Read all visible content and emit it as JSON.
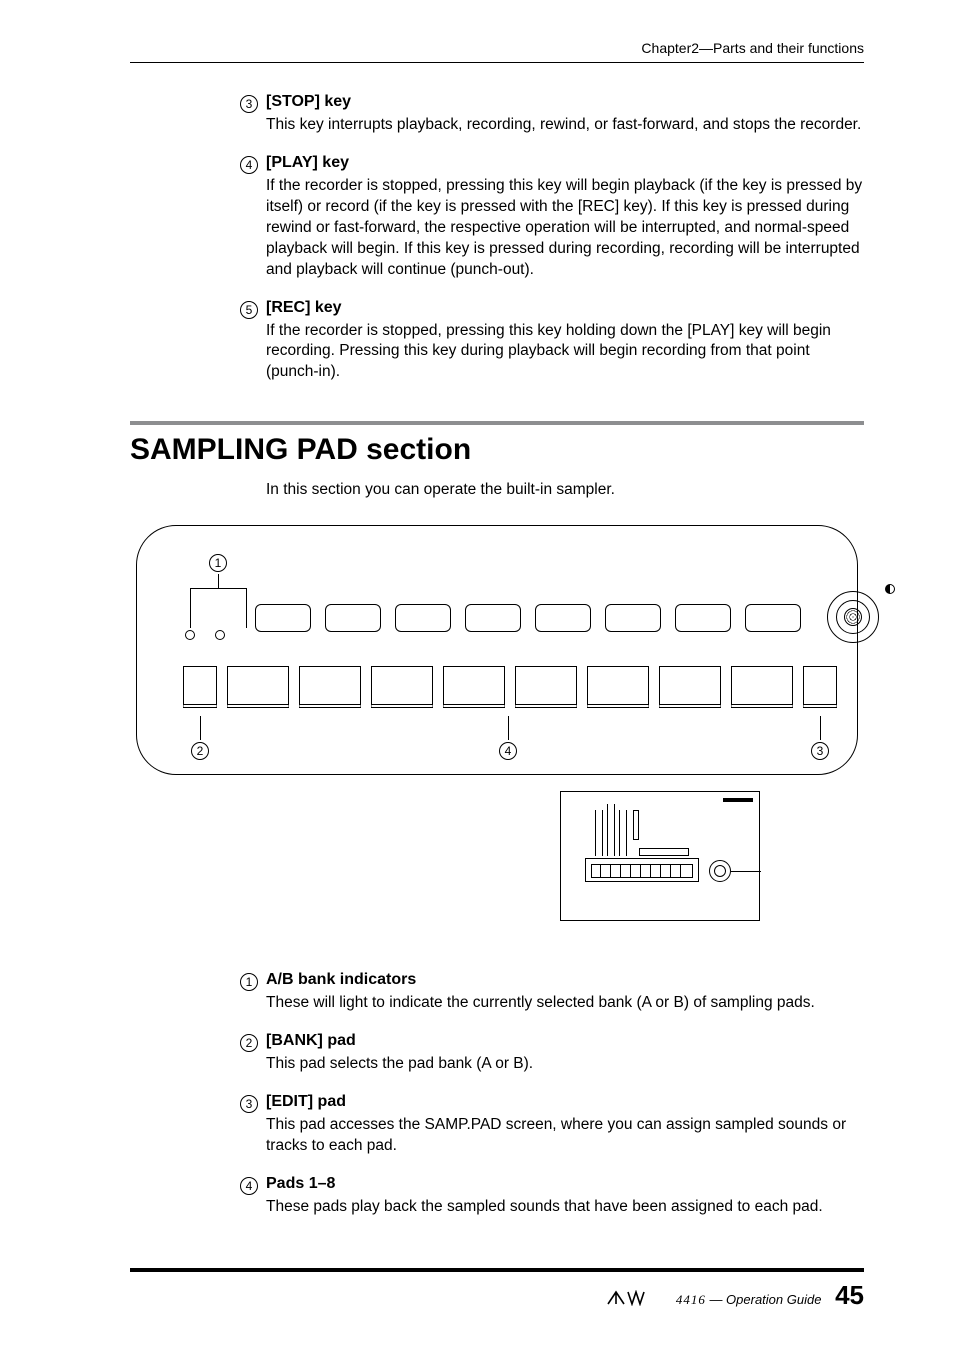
{
  "header": {
    "chapter": "Chapter2—Parts and their functions"
  },
  "top_items": [
    {
      "marker": "3",
      "title": "[STOP] key",
      "desc": "This key interrupts playback, recording, rewind, or fast-forward, and stops the recorder."
    },
    {
      "marker": "4",
      "title": "[PLAY] key",
      "desc": "If the recorder is stopped, pressing this key will begin playback (if the key is pressed by itself) or record (if the key is pressed with the [REC] key). If this key is pressed during rewind or fast-forward, the respective operation will be interrupted, and normal-speed playback will begin. If this key is pressed during recording, recording will be interrupted and playback will continue (punch-out)."
    },
    {
      "marker": "5",
      "title": "[REC] key",
      "desc": "If the recorder is stopped, pressing this key holding down the [PLAY] key will begin recording. Pressing this key during playback will begin recording from that point (punch-in)."
    }
  ],
  "section": {
    "title": "SAMPLING PAD section",
    "intro": "In this section you can operate the built-in sampler."
  },
  "callouts": {
    "c1": "1",
    "c2": "2",
    "c3": "3",
    "c4": "4"
  },
  "bottom_items": [
    {
      "marker": "1",
      "title": "A/B bank indicators",
      "desc": "These will light to indicate the currently selected bank (A or B) of sampling pads."
    },
    {
      "marker": "2",
      "title": "[BANK] pad",
      "desc": "This pad selects the pad bank (A or B)."
    },
    {
      "marker": "3",
      "title": "[EDIT] pad",
      "desc": "This pad accesses the SAMP.PAD screen, where you can assign sampled sounds or tracks to each pad."
    },
    {
      "marker": "4",
      "title": "Pads 1–8",
      "desc": "These pads play back the sampled sounds that have been assigned to each pad."
    }
  ],
  "footer": {
    "model_prefix": "",
    "model": "4416",
    "guide": " — Operation Guide",
    "page": "45"
  }
}
